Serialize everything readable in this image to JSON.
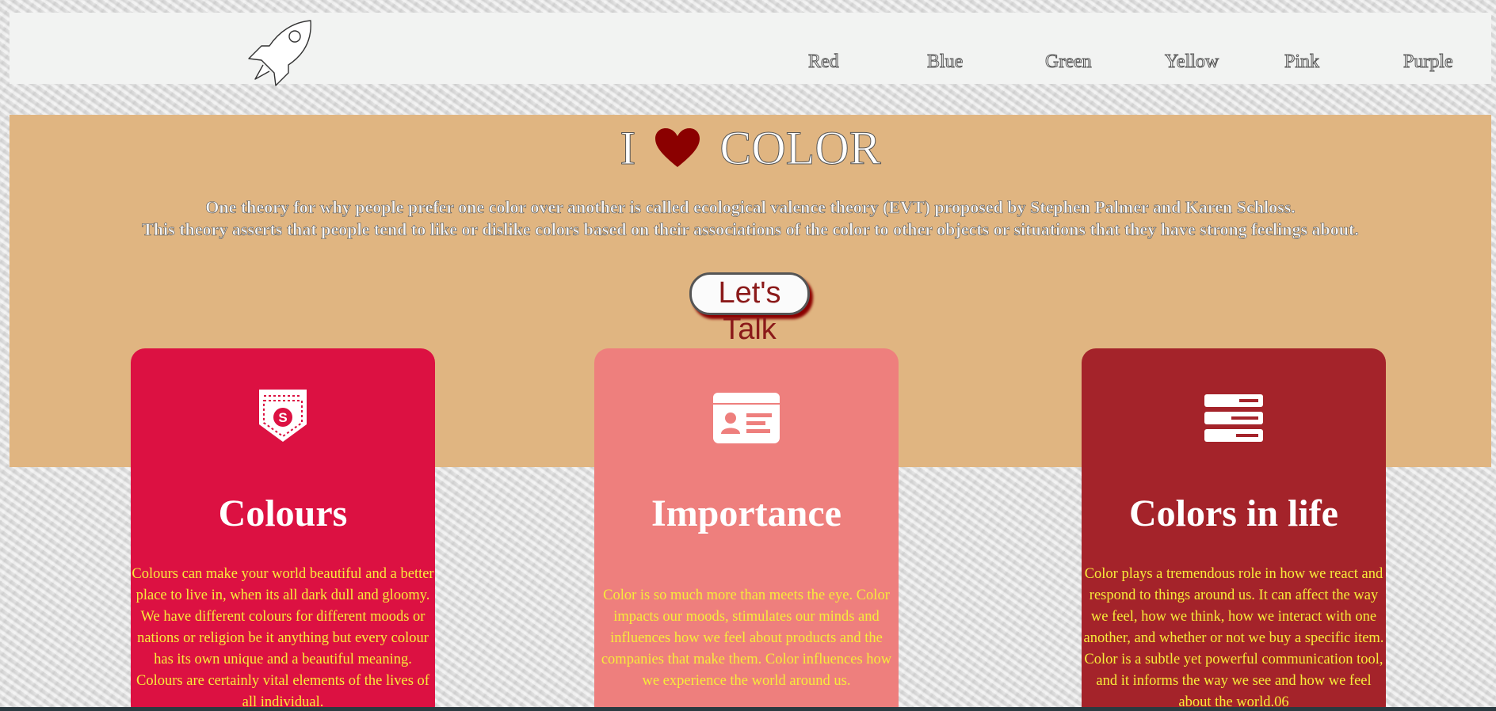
{
  "nav": {
    "logo_icon": "rocket-icon",
    "items": [
      "Red",
      "Blue",
      "Green",
      "Yellow",
      "Pink",
      "Purple"
    ]
  },
  "hero": {
    "title_left": "I",
    "title_icon": "heart-icon",
    "title_right": "COLOR",
    "text_line1": "One theory for why people prefer one color over another is called ecological valence theory (EVT) proposed by Stephen Palmer and Karen Schloss.",
    "text_line2": "This theory asserts that people tend to like or dislike colors based on their associations of the color to other objects or situations that they have strong feelings about.",
    "button_label": "Let's Talk",
    "background_color": "#e0b581"
  },
  "cards": [
    {
      "icon": "pocket-badge-icon",
      "title": "Colours",
      "text": "Colours can make your world beautiful and a better place to live in, when its all dark dull and gloomy. We have different colours for different moods or nations or religion be it anything but every colour has its own unique and a beautiful meaning. Colours are certainly vital elements of the lives of all individual.",
      "color": "#dc1142"
    },
    {
      "icon": "id-card-icon",
      "title": "Importance",
      "text": "Color is so much more than meets the eye. Color impacts our moods, stimulates our minds and influences how we feel about products and the companies that make them. Color influences how we experience the world around us.",
      "color": "#ee7f7d"
    },
    {
      "icon": "server-stack-icon",
      "title": "Colors in life",
      "text": "Color plays a tremendous role in how we react and respond to things around us. It can affect the way we feel, how we think, how we interact with one another, and whether or not we buy a specific item. Color is a subtle yet powerful communication tool, and it informs the way we see and how we feel about the world.06",
      "color": "#a4232a"
    }
  ]
}
